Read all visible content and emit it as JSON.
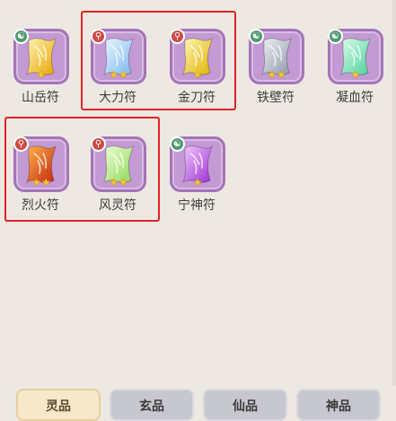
{
  "items": [
    {
      "label": "山岳符",
      "badge": "taiji",
      "stars": 1,
      "color_a": "#fff3b0",
      "color_b": "#e9a400"
    },
    {
      "label": "大力符",
      "badge": "person",
      "stars": 2,
      "color_a": "#e9f6ff",
      "color_b": "#7db6ef"
    },
    {
      "label": "金刀符",
      "badge": "person",
      "stars": 1,
      "color_a": "#fff6b5",
      "color_b": "#e0b200"
    },
    {
      "label": "铁壁符",
      "badge": "taiji",
      "stars": 2,
      "color_a": "#eef0f5",
      "color_b": "#8e97a8"
    },
    {
      "label": "凝血符",
      "badge": "taiji",
      "stars": 1,
      "color_a": "#dafbea",
      "color_b": "#4ed19a"
    },
    {
      "label": "烈火符",
      "badge": "person",
      "stars": 2,
      "color_a": "#ffb24a",
      "color_b": "#c3260f"
    },
    {
      "label": "风灵符",
      "badge": "person",
      "stars": 2,
      "color_a": "#ecffd2",
      "color_b": "#8fd75a"
    },
    {
      "label": "宁神符",
      "badge": "taiji",
      "stars": 1,
      "color_a": "#f2c8ff",
      "color_b": "#9a2fd2"
    }
  ],
  "tabs": [
    {
      "label": "灵品",
      "active": true
    },
    {
      "label": "玄品",
      "active": false
    },
    {
      "label": "仙品",
      "active": false
    },
    {
      "label": "神品",
      "active": false
    }
  ],
  "icons": {
    "badge_taiji": "taiji-icon",
    "badge_person": "person-icon",
    "star": "star-icon"
  },
  "colors": {
    "highlight": "#e02424",
    "card_bg": "#c39ad4",
    "active_tab": "#f6e8c8",
    "inactive_tab": "#c7c7cf"
  }
}
